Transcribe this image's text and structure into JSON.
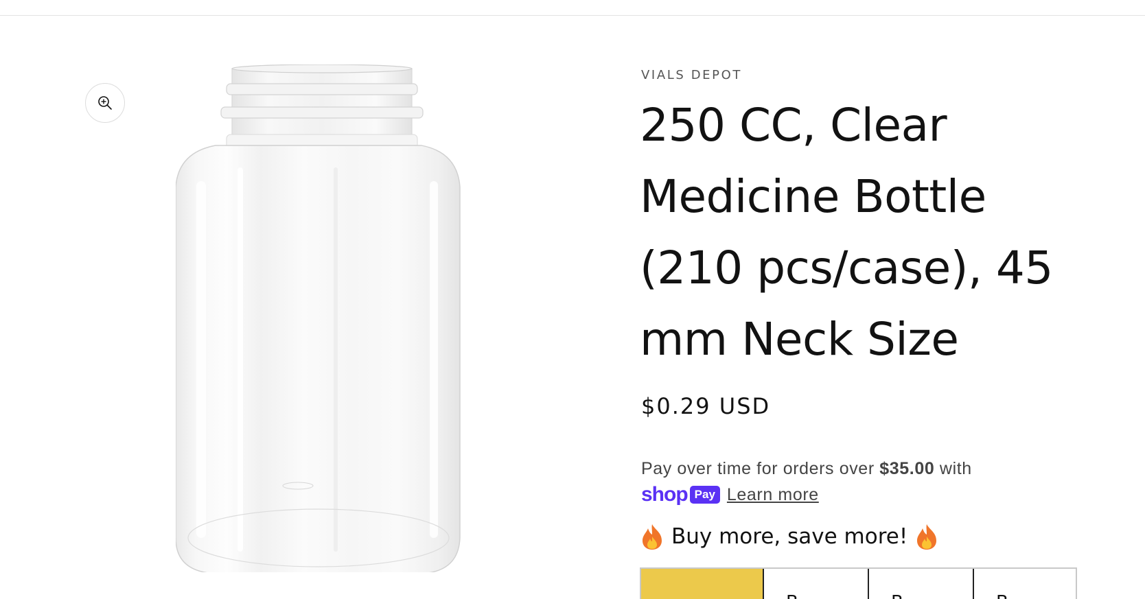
{
  "product": {
    "vendor": "VIALS DEPOT",
    "title": "250 CC, Clear Medicine Bottle (210 pcs/case), 45 mm Neck Size",
    "price": "$0.29 USD",
    "image_alt": "clear-plastic-bottle"
  },
  "installments": {
    "prefix": "Pay over time for orders over ",
    "threshold": "$35.00",
    "suffix": " with",
    "shop_label": "shop",
    "pay_label": "Pay",
    "learn_more": "Learn more"
  },
  "promo": {
    "text": "Buy more, save more!",
    "icon": "fire-icon"
  },
  "tiers": [
    {
      "label": "",
      "active": true
    },
    {
      "label": "B",
      "active": false
    },
    {
      "label": "B",
      "active": false
    },
    {
      "label": "B",
      "active": false
    }
  ],
  "colors": {
    "accent_yellow": "#ecc94b",
    "shop_pay_purple": "#5a31f4"
  }
}
